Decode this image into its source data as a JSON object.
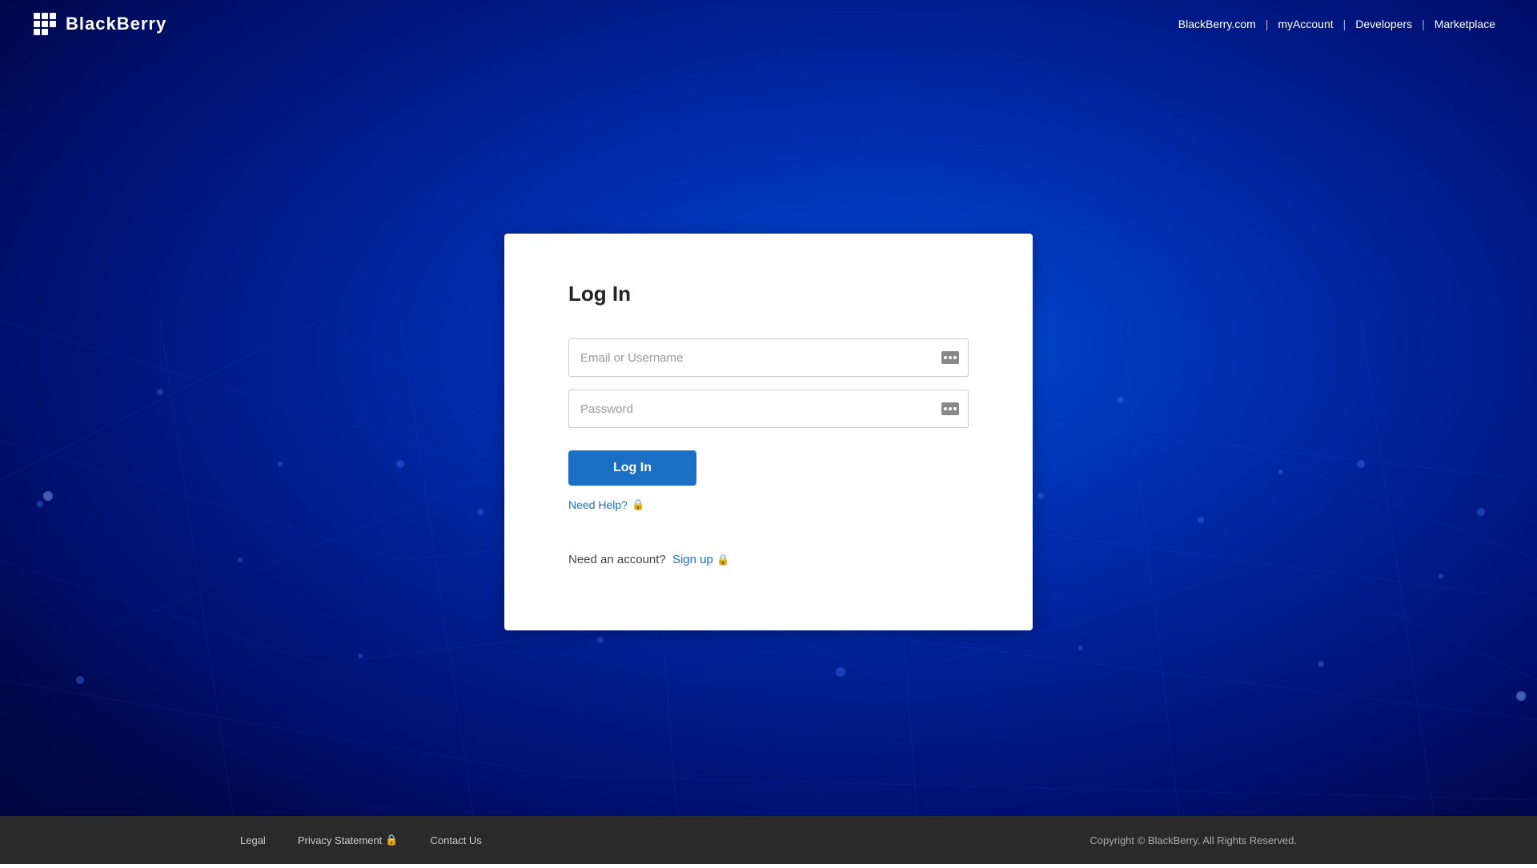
{
  "header": {
    "logo_text": "BlackBerry",
    "nav": {
      "blackberry_com": "BlackBerry.com",
      "my_account": "myAccount",
      "developers": "Developers",
      "marketplace": "Marketplace"
    }
  },
  "login_card": {
    "title": "Log In",
    "email_placeholder": "Email or Username",
    "password_placeholder": "Password",
    "login_button": "Log In",
    "need_help": "Need Help?",
    "signup_text": "Need an account?",
    "signup_link": "Sign up"
  },
  "footer": {
    "legal": "Legal",
    "privacy_statement": "Privacy Statement",
    "contact_us": "Contact Us",
    "copyright": "Copyright © BlackBerry. All Rights Reserved."
  }
}
